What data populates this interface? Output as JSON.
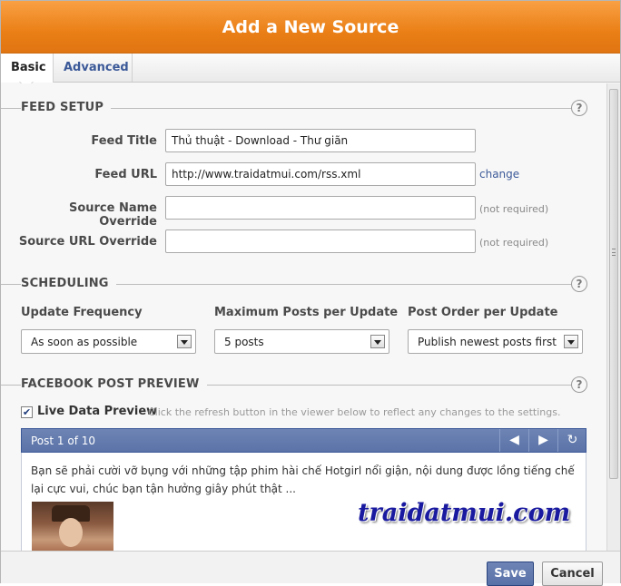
{
  "dialog": {
    "title": "Add a New Source",
    "tabs": [
      {
        "label": "Basic",
        "active": true
      },
      {
        "label": "Advanced",
        "active": false
      }
    ]
  },
  "feed_setup": {
    "heading": "FEED SETUP",
    "help": "?",
    "feed_title_label": "Feed Title",
    "feed_title_value": "Thủ thuật - Download - Thư giãn",
    "feed_url_label": "Feed URL",
    "feed_url_value": "http://www.traidatmui.com/rss.xml",
    "change_link": "change",
    "source_name_label": "Source Name Override",
    "source_name_value": "",
    "source_url_label": "Source URL Override",
    "source_url_value": "",
    "not_required": "(not required)"
  },
  "scheduling": {
    "heading": "SCHEDULING",
    "help": "?",
    "update_frequency_label": "Update Frequency",
    "update_frequency_value": "As soon as possible",
    "max_posts_label": "Maximum Posts per Update",
    "max_posts_value": "5 posts",
    "post_order_label": "Post Order per Update",
    "post_order_value": "Publish newest posts first"
  },
  "preview": {
    "heading": "FACEBOOK POST PREVIEW",
    "help": "?",
    "live_checked": true,
    "live_label": "Live Data Preview",
    "live_hint": "Click the refresh button in the viewer below to reflect any changes to the settings.",
    "viewer_title": "Post 1 of 10",
    "post_text": "Bạn sẽ phải cười vỡ bụng với những tập phim hài chế Hotgirl nổi giận, nội dung được lồng tiếng chế lại cực vui, chúc bạn tận hưởng giây phút thật ...",
    "watermark": "traidatmui.com"
  },
  "footer": {
    "save_label": "Save",
    "cancel_label": "Cancel"
  },
  "colors": {
    "title_bar": "#ea7f16",
    "facebook_blue": "#3b5998",
    "viewer_bar": "#6d84b4"
  },
  "icons": {
    "prev": "triangle-left-icon",
    "next": "triangle-right-icon",
    "refresh": "refresh-icon",
    "help": "help-icon",
    "dropdown": "chevron-down-icon"
  }
}
